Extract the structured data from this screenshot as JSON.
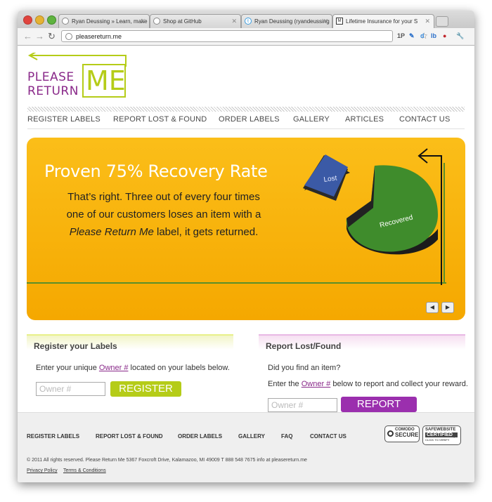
{
  "browser": {
    "tabs": [
      {
        "label": "Ryan Deussing » Learn, make",
        "active": false
      },
      {
        "label": "Shop at GitHub",
        "active": false
      },
      {
        "label": "Ryan Deussing (ryandeussing",
        "active": false
      },
      {
        "label": "Lifetime Insurance for your S",
        "active": true
      }
    ],
    "url": "pleasereturn.me",
    "ext_1p": "1P",
    "ext_d": "d",
    "ext_lb": "lb"
  },
  "logo": {
    "line1": "PLEASE",
    "line2": "RETURN",
    "me": "ME"
  },
  "nav": {
    "items": [
      "REGISTER LABELS",
      "REPORT LOST & FOUND",
      "ORDER LABELS",
      "GALLERY",
      "ARTICLES",
      "CONTACT US"
    ]
  },
  "hero": {
    "title": "Proven 75% Recovery Rate",
    "body_line1": "That’s right. Three out of every four times",
    "body_line2": "one of our customers loses an item with a",
    "body_em": "Please Return Me",
    "body_line3": " label, it gets returned.",
    "pie_lost": "Lost",
    "pie_recovered": "Recovered",
    "pager_prev": "◀",
    "pager_next": "▶"
  },
  "register": {
    "heading": "Register your Labels",
    "text_before": "Enter your unique ",
    "link": "Owner #",
    "text_after": " located on your labels below.",
    "placeholder": "Owner #",
    "button": "REGISTER"
  },
  "report": {
    "heading": "Report Lost/Found",
    "question": "Did you find an item?",
    "text_before": "Enter the ",
    "link": "Owner #",
    "text_after": " below to report and collect your reward.",
    "placeholder": "Owner #",
    "button": "REPORT"
  },
  "footer": {
    "nav": [
      "REGISTER LABELS",
      "REPORT LOST & FOUND",
      "ORDER LABELS",
      "GALLERY",
      "FAQ",
      "CONTACT US"
    ],
    "copyright": "© 2011 All rights reserved.   Please Return Me   5367 Foxcroft Drive, Kalamazoo, MI 49009   T 888 548 7675   info at pleasereturn.me",
    "privacy": "Privacy Policy",
    "terms": "Terms & Conditions",
    "badge_comodo_1": "COMODO",
    "badge_comodo_2": "SECURE",
    "badge_safe_1": "SAFEWEBSITE",
    "badge_safe_2": "CERTIFIED",
    "badge_safe_3": "CLICK TO VERIFY"
  },
  "colors": {
    "brand_purple": "#8a2a8a",
    "brand_green": "#b5cc18",
    "hero_orange": "#f9b300",
    "report_purple": "#9b2fae"
  }
}
